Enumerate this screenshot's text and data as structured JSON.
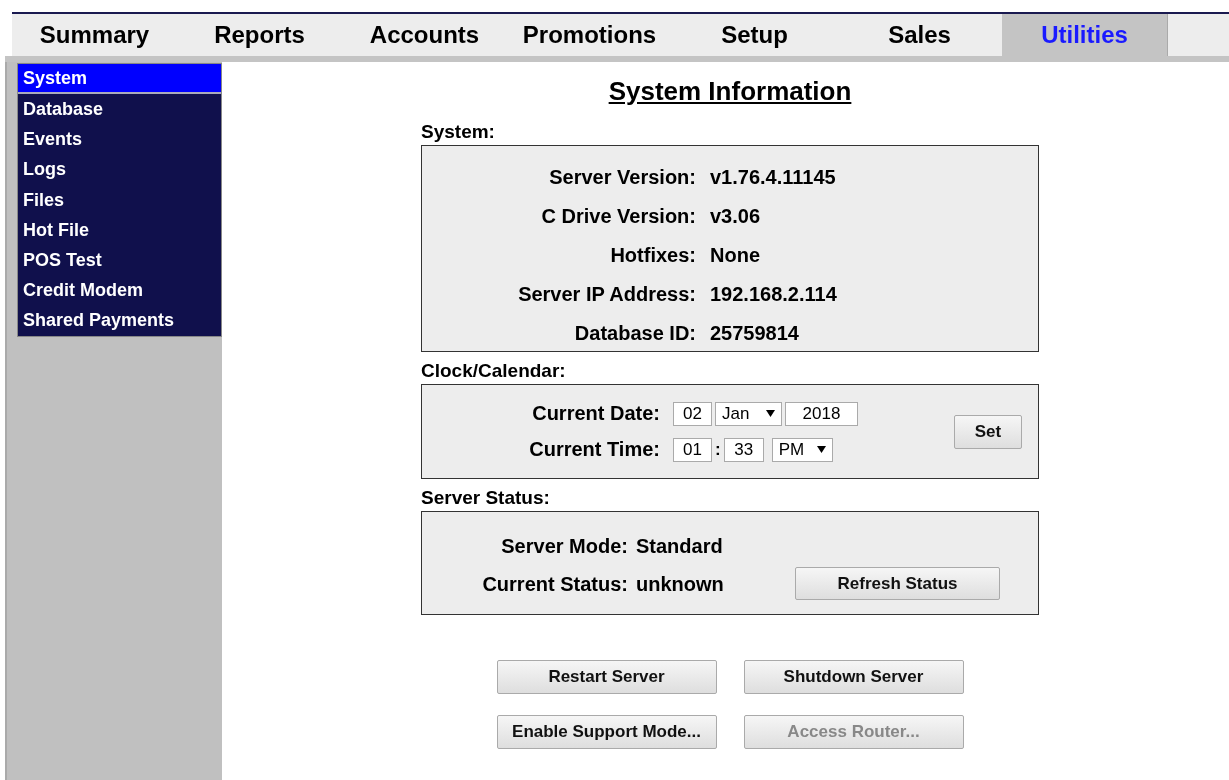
{
  "tabs": [
    {
      "label": "Summary",
      "selected": false
    },
    {
      "label": "Reports",
      "selected": false
    },
    {
      "label": "Accounts",
      "selected": false
    },
    {
      "label": "Promotions",
      "selected": false
    },
    {
      "label": "Setup",
      "selected": false
    },
    {
      "label": "Sales",
      "selected": false
    },
    {
      "label": "Utilities",
      "selected": true
    }
  ],
  "sidebar": {
    "items": [
      {
        "label": "System",
        "selected": true
      },
      {
        "label": "Database",
        "selected": false
      },
      {
        "label": "Events",
        "selected": false
      },
      {
        "label": "Logs",
        "selected": false
      },
      {
        "label": "Files",
        "selected": false
      },
      {
        "label": "Hot File",
        "selected": false
      },
      {
        "label": "POS Test",
        "selected": false
      },
      {
        "label": "Credit Modem",
        "selected": false
      },
      {
        "label": "Shared Payments",
        "selected": false
      }
    ]
  },
  "title": "System Information",
  "system": {
    "heading": "System:",
    "rows": [
      {
        "label": "Server Version:",
        "value": "v1.76.4.11145"
      },
      {
        "label": "C Drive Version:",
        "value": "v3.06"
      },
      {
        "label": "Hotfixes:",
        "value": "None"
      },
      {
        "label": "Server IP Address:",
        "value": "192.168.2.114"
      },
      {
        "label": "Database ID:",
        "value": "25759814"
      }
    ]
  },
  "clock": {
    "heading": "Clock/Calendar:",
    "date_label": "Current Date:",
    "day": "02",
    "month": "Jan",
    "year": "2018",
    "time_label": "Current Time:",
    "hour": "01",
    "separator": ":",
    "minute": "33",
    "ampm": "PM",
    "set_button": "Set"
  },
  "server_status": {
    "heading": "Server Status:",
    "rows": [
      {
        "label": "Server Mode:",
        "value": "Standard"
      },
      {
        "label": "Current Status:",
        "value": "unknown"
      }
    ],
    "refresh_button": "Refresh Status"
  },
  "buttons": [
    {
      "label": "Restart Server",
      "disabled": false
    },
    {
      "label": "Shutdown Server",
      "disabled": false
    },
    {
      "label": "Enable Support Mode...",
      "disabled": false
    },
    {
      "label": "Access Router...",
      "disabled": true
    }
  ]
}
